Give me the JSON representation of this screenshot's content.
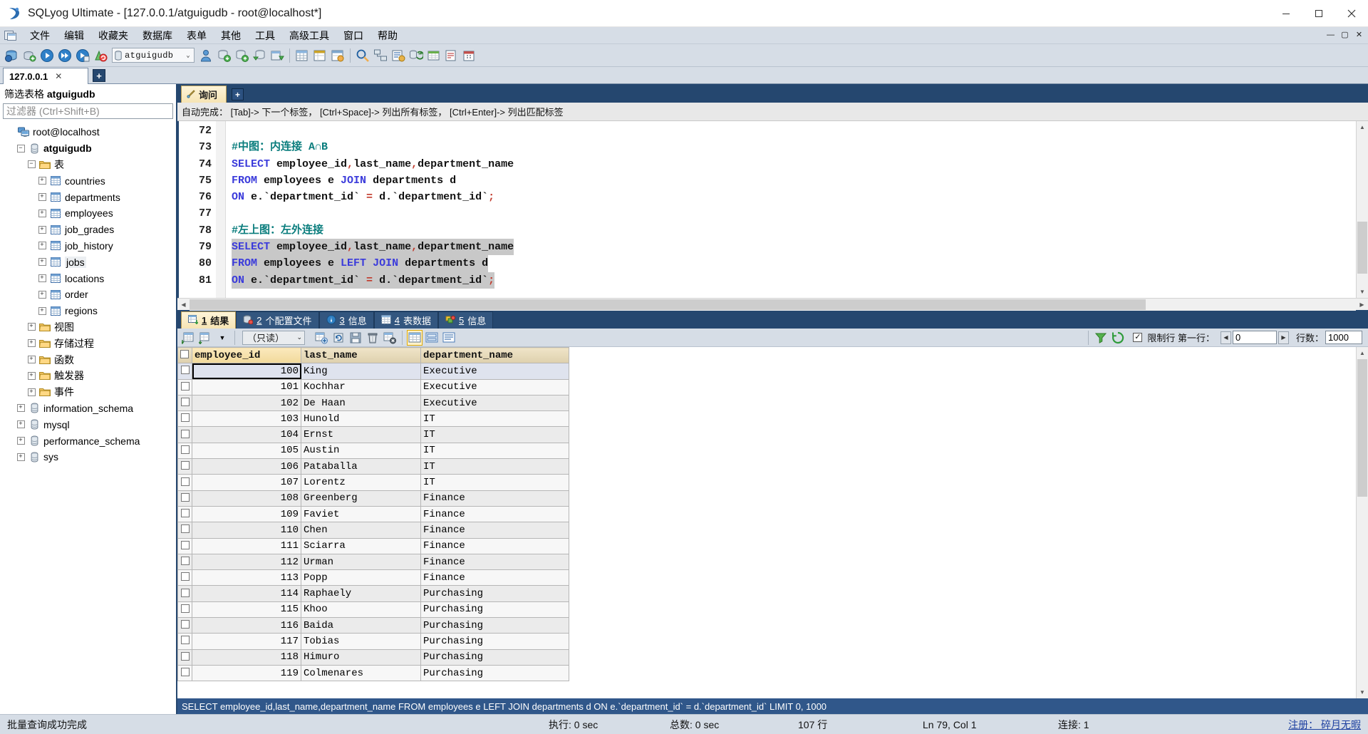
{
  "window": {
    "title": "SQLyog Ultimate - [127.0.0.1/atguigudb - root@localhost*]",
    "minimize": "—",
    "maximize": "▢",
    "close": "✕"
  },
  "menu": {
    "items": [
      {
        "label": "文件",
        "name": "menu-file"
      },
      {
        "label": "编辑",
        "name": "menu-edit"
      },
      {
        "label": "收藏夹",
        "name": "menu-favorites"
      },
      {
        "label": "数据库",
        "name": "menu-database"
      },
      {
        "label": "表单",
        "name": "menu-form"
      },
      {
        "label": "其他",
        "name": "menu-others"
      },
      {
        "label": "工具",
        "name": "menu-tools"
      },
      {
        "label": "高级工具",
        "name": "menu-advanced-tools"
      },
      {
        "label": "窗口",
        "name": "menu-window"
      },
      {
        "label": "帮助",
        "name": "menu-help"
      }
    ],
    "mdi": {
      "restore": "—",
      "maximize": "▢",
      "close": "✕"
    }
  },
  "toolbar": {
    "database_selector": {
      "value": "atguigudb",
      "arrow": "⌄"
    }
  },
  "connection_tabs": {
    "tabs": [
      {
        "label": "127.0.0.1",
        "close": "✕"
      }
    ],
    "add_label": "+"
  },
  "sidebar": {
    "filter_title_prefix": "筛选表格 ",
    "filter_title_db": "atguigudb",
    "filter_placeholder": "过滤器 (Ctrl+Shift+B)",
    "tree": [
      {
        "label": "root@localhost",
        "indent": 0,
        "icon": "server-icon",
        "expander": "",
        "bold": false
      },
      {
        "label": "atguigudb",
        "indent": 1,
        "icon": "database-icon",
        "expander": "−",
        "bold": true
      },
      {
        "label": "表",
        "indent": 2,
        "icon": "folder-icon",
        "expander": "−",
        "bold": false
      },
      {
        "label": "countries",
        "indent": 3,
        "icon": "table-icon",
        "expander": "+",
        "bold": false
      },
      {
        "label": "departments",
        "indent": 3,
        "icon": "table-icon",
        "expander": "+",
        "bold": false
      },
      {
        "label": "employees",
        "indent": 3,
        "icon": "table-icon",
        "expander": "+",
        "bold": false
      },
      {
        "label": "job_grades",
        "indent": 3,
        "icon": "table-icon",
        "expander": "+",
        "bold": false
      },
      {
        "label": "job_history",
        "indent": 3,
        "icon": "table-icon",
        "expander": "+",
        "bold": false
      },
      {
        "label": "jobs",
        "indent": 3,
        "icon": "table-icon",
        "expander": "+",
        "bold": false,
        "selected": true
      },
      {
        "label": "locations",
        "indent": 3,
        "icon": "table-icon",
        "expander": "+",
        "bold": false
      },
      {
        "label": "order",
        "indent": 3,
        "icon": "table-icon",
        "expander": "+",
        "bold": false
      },
      {
        "label": "regions",
        "indent": 3,
        "icon": "table-icon",
        "expander": "+",
        "bold": false
      },
      {
        "label": "视图",
        "indent": 2,
        "icon": "folder-icon",
        "expander": "+",
        "bold": false
      },
      {
        "label": "存储过程",
        "indent": 2,
        "icon": "folder-icon",
        "expander": "+",
        "bold": false
      },
      {
        "label": "函数",
        "indent": 2,
        "icon": "folder-icon",
        "expander": "+",
        "bold": false
      },
      {
        "label": "触发器",
        "indent": 2,
        "icon": "folder-icon",
        "expander": "+",
        "bold": false
      },
      {
        "label": "事件",
        "indent": 2,
        "icon": "folder-icon",
        "expander": "+",
        "bold": false
      },
      {
        "label": "information_schema",
        "indent": 1,
        "icon": "database-icon",
        "expander": "+",
        "bold": false
      },
      {
        "label": "mysql",
        "indent": 1,
        "icon": "database-icon",
        "expander": "+",
        "bold": false
      },
      {
        "label": "performance_schema",
        "indent": 1,
        "icon": "database-icon",
        "expander": "+",
        "bold": false
      },
      {
        "label": "sys",
        "indent": 1,
        "icon": "database-icon",
        "expander": "+",
        "bold": false
      }
    ]
  },
  "query": {
    "tabs": [
      {
        "label": "询问"
      }
    ],
    "add_label": "+",
    "hint": "自动完成： [Tab]-> 下一个标签， [Ctrl+Space]-> 列出所有标签， [Ctrl+Enter]-> 列出匹配标签",
    "lines": [
      {
        "no": "72",
        "tokens": [],
        "selected": false
      },
      {
        "no": "73",
        "tokens": [
          {
            "t": "#中图：内连接 A∩B",
            "c": "cmt"
          }
        ],
        "selected": false
      },
      {
        "no": "74",
        "tokens": [
          {
            "t": "SELECT",
            "c": "kw"
          },
          {
            "t": " employee_id",
            "c": ""
          },
          {
            "t": ",",
            "c": "op"
          },
          {
            "t": "last_name",
            "c": ""
          },
          {
            "t": ",",
            "c": "op"
          },
          {
            "t": "department_name",
            "c": ""
          }
        ],
        "selected": false
      },
      {
        "no": "75",
        "tokens": [
          {
            "t": "FROM",
            "c": "kw"
          },
          {
            "t": " employees e ",
            "c": ""
          },
          {
            "t": "JOIN",
            "c": "kw"
          },
          {
            "t": " departments d",
            "c": ""
          }
        ],
        "selected": false
      },
      {
        "no": "76",
        "tokens": [
          {
            "t": "ON",
            "c": "kw"
          },
          {
            "t": " e.`department_id` ",
            "c": ""
          },
          {
            "t": "=",
            "c": "op"
          },
          {
            "t": " d.`department_id`",
            "c": ""
          },
          {
            "t": ";",
            "c": "op"
          }
        ],
        "selected": false
      },
      {
        "no": "77",
        "tokens": [],
        "selected": false
      },
      {
        "no": "78",
        "tokens": [
          {
            "t": "#左上图：左外连接",
            "c": "cmt"
          }
        ],
        "selected": false
      },
      {
        "no": "79",
        "tokens": [
          {
            "t": "SELECT",
            "c": "kw"
          },
          {
            "t": " employee_id",
            "c": ""
          },
          {
            "t": ",",
            "c": "op"
          },
          {
            "t": "last_name",
            "c": ""
          },
          {
            "t": ",",
            "c": "op"
          },
          {
            "t": "department_name",
            "c": ""
          }
        ],
        "selected": true
      },
      {
        "no": "80",
        "tokens": [
          {
            "t": "FROM",
            "c": "kw"
          },
          {
            "t": " employees e ",
            "c": ""
          },
          {
            "t": "LEFT",
            "c": "kw"
          },
          {
            "t": " ",
            "c": ""
          },
          {
            "t": "JOIN",
            "c": "kw"
          },
          {
            "t": " departments d",
            "c": ""
          }
        ],
        "selected": true
      },
      {
        "no": "81",
        "tokens": [
          {
            "t": "ON",
            "c": "kw"
          },
          {
            "t": " e.`department_id` ",
            "c": ""
          },
          {
            "t": "=",
            "c": "op"
          },
          {
            "t": " d.`department_id`",
            "c": ""
          },
          {
            "t": ";",
            "c": "op"
          }
        ],
        "selected": true
      }
    ]
  },
  "results": {
    "tabs": [
      {
        "num": "1",
        "label": "结果",
        "icon": "result-grid-icon",
        "active": true
      },
      {
        "num": "2",
        "label": "个配置文件",
        "icon": "profile-icon",
        "active": false
      },
      {
        "num": "3",
        "label": "信息",
        "icon": "info-icon",
        "active": false
      },
      {
        "num": "4",
        "label": "表数据",
        "icon": "table-data-icon",
        "active": false
      },
      {
        "num": "5",
        "label": "信息",
        "icon": "messages-icon",
        "active": false
      }
    ],
    "toolbar": {
      "readonly_value": "（只读）",
      "readonly_arrow": "⌄",
      "limit_checkbox": "✓",
      "limit_label": "限制行 第一行：",
      "prev_arrow": "◀",
      "offset_value": "0",
      "next_arrow": "▶",
      "rows_label": "行数：",
      "rows_value": "1000"
    },
    "columns": [
      "employee_id",
      "last_name",
      "department_name"
    ],
    "rows": [
      [
        "100",
        "King",
        "Executive"
      ],
      [
        "101",
        "Kochhar",
        "Executive"
      ],
      [
        "102",
        "De Haan",
        "Executive"
      ],
      [
        "103",
        "Hunold",
        "IT"
      ],
      [
        "104",
        "Ernst",
        "IT"
      ],
      [
        "105",
        "Austin",
        "IT"
      ],
      [
        "106",
        "Pataballa",
        "IT"
      ],
      [
        "107",
        "Lorentz",
        "IT"
      ],
      [
        "108",
        "Greenberg",
        "Finance"
      ],
      [
        "109",
        "Faviet",
        "Finance"
      ],
      [
        "110",
        "Chen",
        "Finance"
      ],
      [
        "111",
        "Sciarra",
        "Finance"
      ],
      [
        "112",
        "Urman",
        "Finance"
      ],
      [
        "113",
        "Popp",
        "Finance"
      ],
      [
        "114",
        "Raphaely",
        "Purchasing"
      ],
      [
        "115",
        "Khoo",
        "Purchasing"
      ],
      [
        "116",
        "Baida",
        "Purchasing"
      ],
      [
        "117",
        "Tobias",
        "Purchasing"
      ],
      [
        "118",
        "Himuro",
        "Purchasing"
      ],
      [
        "119",
        "Colmenares",
        "Purchasing"
      ]
    ],
    "executed_sql": "SELECT employee_id,last_name,department_name FROM employees e LEFT JOIN departments d ON e.`department_id` = d.`department_id` LIMIT 0, 1000"
  },
  "statusbar": {
    "message": "批量查询成功完成",
    "exec_time": "执行: 0 sec",
    "total_time": "总数: 0 sec",
    "row_count": "107 行",
    "cursor": "Ln 79, Col 1",
    "connections": "连接: 1",
    "register": "注册： 碎月无暇"
  },
  "colors": {
    "accent_blue": "#25476f",
    "menu_bg": "#d6dde6",
    "tab_active": "#f6e4b4",
    "keyword": "#3b3bdb",
    "comment": "#0a7d7d",
    "operator": "#c0392b"
  }
}
